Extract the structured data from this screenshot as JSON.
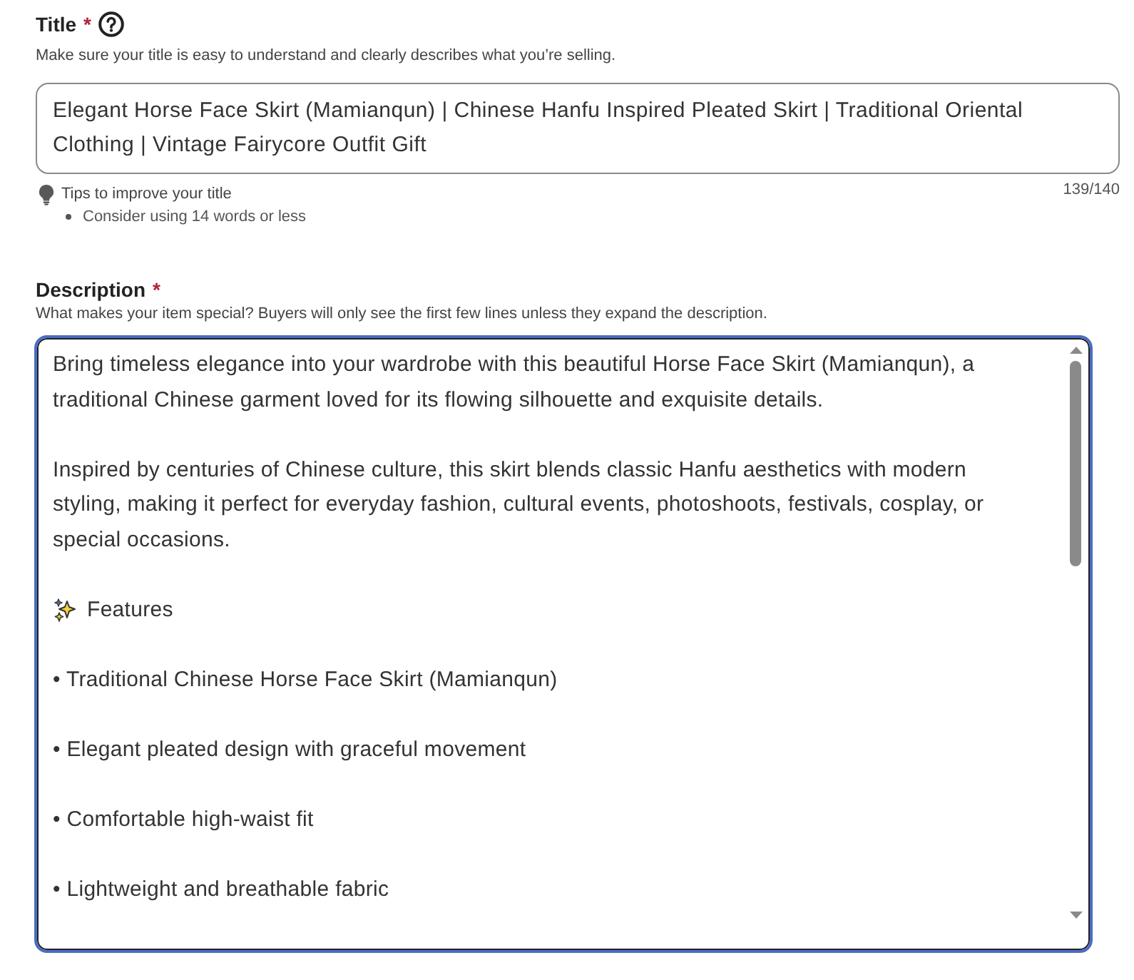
{
  "title": {
    "label": "Title",
    "required_mark": "*",
    "hint": "Make sure your title is easy to understand and clearly describes what you’re selling.",
    "value": "Elegant Horse Face Skirt (Mamianqun) | Chinese Hanfu Inspired Pleated Skirt | Traditional Oriental Clothing | Vintage Fairycore Outfit Gift",
    "tips": {
      "heading": "Tips to improve your title",
      "items": [
        "Consider using 14 words or less"
      ]
    },
    "counter": "139/140"
  },
  "description": {
    "label": "Description",
    "required_mark": "*",
    "hint": "What makes your item special? Buyers will only see the first few lines unless they expand the description.",
    "focused": true,
    "paragraphs": [
      {
        "kind": "text",
        "text": "Bring timeless elegance into your wardrobe with this beautiful Horse Face Skirt (Mamianqun), a traditional Chinese garment loved for its flowing silhouette and exquisite details."
      },
      {
        "kind": "text",
        "text": "Inspired by centuries of Chinese culture, this skirt blends classic Hanfu aesthetics with modern styling, making it perfect for everyday fashion, cultural events, photoshoots, festivals, cosplay, or special occasions."
      },
      {
        "kind": "sparkle_heading",
        "text": "Features"
      },
      {
        "kind": "text",
        "text": "• Traditional Chinese Horse Face Skirt (Mamianqun)"
      },
      {
        "kind": "text",
        "text": "• Elegant pleated design with graceful movement"
      },
      {
        "kind": "text",
        "text": "• Comfortable high-waist fit"
      },
      {
        "kind": "text",
        "text": "• Lightweight and breathable fabric"
      }
    ]
  }
}
